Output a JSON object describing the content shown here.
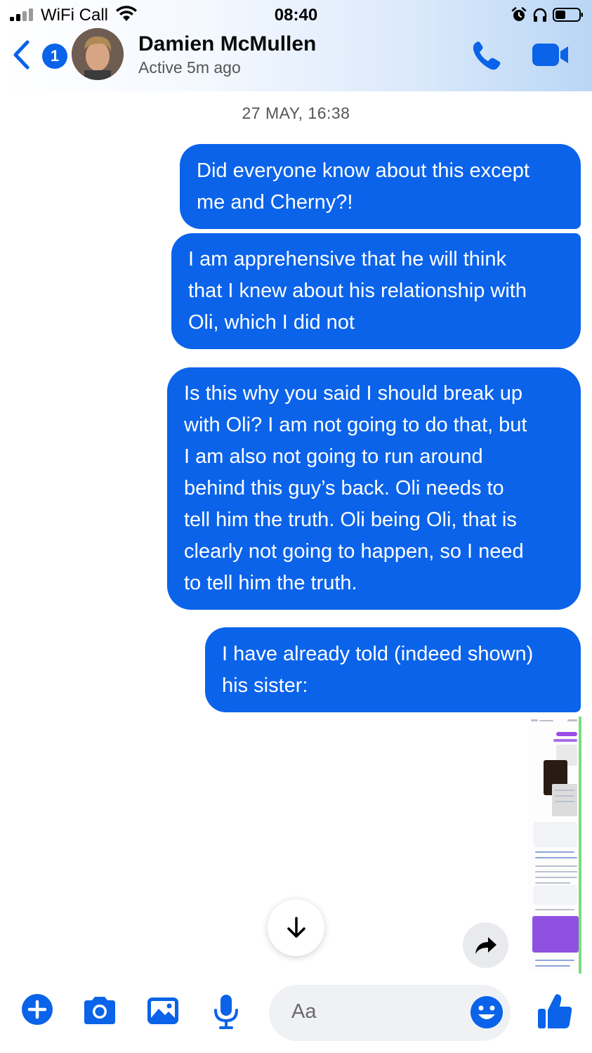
{
  "status_bar": {
    "carrier": "WiFi Call",
    "time": "08:40",
    "icons": [
      "signal-icon",
      "wifi-icon",
      "alarm-icon",
      "headphones-icon",
      "battery-icon"
    ]
  },
  "header": {
    "back_badge": "1",
    "contact_name": "Damien McMullen",
    "contact_status": "Active 5m ago",
    "icons": [
      "back-chevron-icon",
      "avatar",
      "phone-icon",
      "video-camera-icon"
    ]
  },
  "chat": {
    "timestamp": "27 MAY, 16:38",
    "messages": [
      {
        "sender": "me",
        "lines": [
          "Did everyone know about this except",
          "me and Cherny?!"
        ]
      },
      {
        "sender": "me",
        "lines": [
          "I am apprehensive that he will think",
          "that I knew about his relationship with",
          "Oli, which I did not"
        ]
      },
      {
        "sender": "me",
        "lines": [
          "Is this why you said I should break up",
          "with Oli? I am not going to do that, but",
          "I am also not going to run around",
          "behind this guy’s back. Oli needs to",
          "tell him the truth. Oli being Oli, that is",
          "clearly not going to happen, so I need",
          "to tell him the truth."
        ]
      },
      {
        "sender": "me",
        "lines": [
          "I have already told (indeed shown)",
          "his sister:"
        ]
      }
    ],
    "attachment": "screenshot-image",
    "floating_buttons": [
      "scroll-down-arrow-icon",
      "forward-share-icon"
    ]
  },
  "composer": {
    "placeholder": "Aa",
    "icons": [
      "plus-icon",
      "camera-icon",
      "photo-gallery-icon",
      "microphone-icon",
      "emoji-icon",
      "thumbs-up-icon"
    ]
  },
  "colors": {
    "accent": "#0a63e8",
    "bubble": "#0b63ea",
    "header_gradient_end": "#b9d6f5",
    "composer_field": "#f0f1f4"
  }
}
